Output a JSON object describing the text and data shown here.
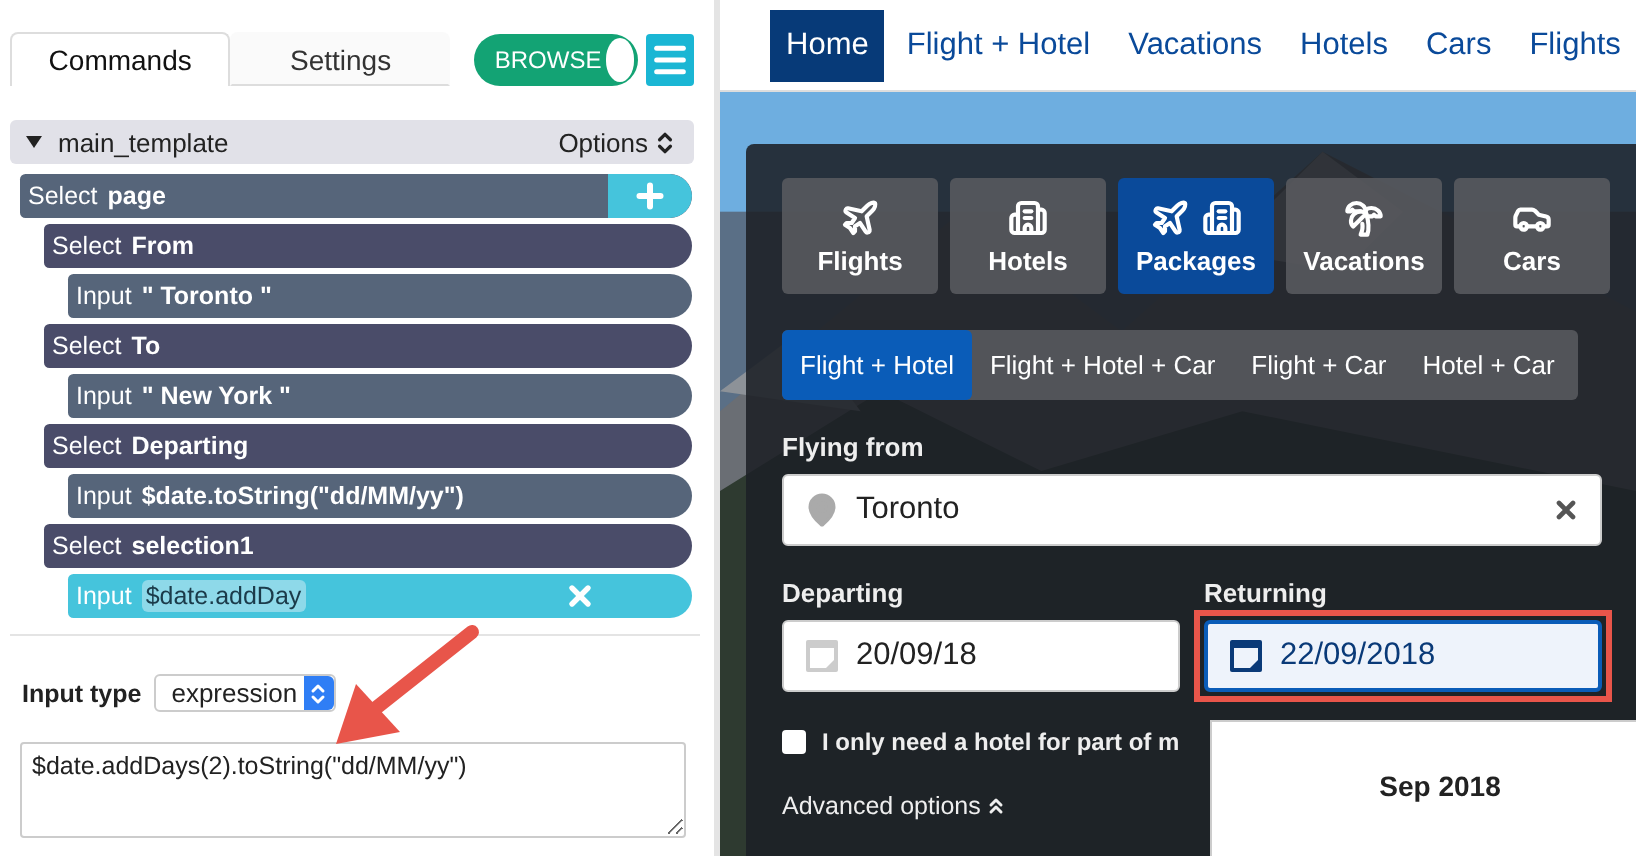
{
  "editor": {
    "tabs": [
      {
        "label": "Commands",
        "selected": true
      },
      {
        "label": "Settings",
        "selected": false
      }
    ],
    "mode_toggle": {
      "label": "BROWSE",
      "on": true
    },
    "template": {
      "name": "main_template",
      "expanded": true,
      "options_label": "Options"
    },
    "steps": [
      {
        "verb": "Select",
        "value": "page",
        "selected": false,
        "children": [
          {
            "verb": "Select",
            "value": "From",
            "selected": false,
            "children": [
              {
                "verb": "Input",
                "value": "\" Toronto \"",
                "selected": false
              }
            ]
          },
          {
            "verb": "Select",
            "value": "To",
            "selected": false,
            "children": [
              {
                "verb": "Input",
                "value": "\" New York \"",
                "selected": false
              }
            ]
          },
          {
            "verb": "Select",
            "value": "Departing",
            "selected": false,
            "children": [
              {
                "verb": "Input",
                "value": "$date.toString(\"dd/MM/yy\")",
                "selected": false
              }
            ]
          },
          {
            "verb": "Select",
            "value": "selection1",
            "selected": false,
            "children": [
              {
                "verb": "Input",
                "value": "$date.addDay",
                "selected": true
              }
            ]
          }
        ]
      }
    ],
    "input_type": {
      "label": "Input type",
      "value": "expression"
    },
    "expression": "$date.addDays(2).toString(\"dd/MM/yy\")"
  },
  "site": {
    "nav": [
      {
        "label": "Home",
        "selected": true
      },
      {
        "label": "Flight + Hotel",
        "selected": false
      },
      {
        "label": "Vacations",
        "selected": false
      },
      {
        "label": "Hotels",
        "selected": false
      },
      {
        "label": "Cars",
        "selected": false
      },
      {
        "label": "Flights",
        "selected": false
      }
    ],
    "categories": [
      {
        "label": "Flights",
        "kind": "flight",
        "selected": false
      },
      {
        "label": "Hotels",
        "kind": "hotel",
        "selected": false
      },
      {
        "label": "Packages",
        "kind": "package",
        "selected": true
      },
      {
        "label": "Vacations",
        "kind": "vacation",
        "selected": false
      },
      {
        "label": "Cars",
        "kind": "car",
        "selected": false
      }
    ],
    "package_types": [
      {
        "label": "Flight + Hotel",
        "selected": true
      },
      {
        "label": "Flight + Hotel + Car",
        "selected": false
      },
      {
        "label": "Flight + Car",
        "selected": false
      },
      {
        "label": "Hotel + Car",
        "selected": false
      }
    ],
    "flying_from": {
      "label": "Flying from",
      "value": "Toronto"
    },
    "departing": {
      "label": "Departing",
      "value": "20/09/18",
      "focused": false
    },
    "returning": {
      "label": "Returning",
      "value": "22/09/2018",
      "focused": true
    },
    "partial_hotel": {
      "label": "I only need a hotel for part of m",
      "checked": false
    },
    "advanced_options": "Advanced options",
    "calendar": {
      "month": "Sep 2018"
    }
  }
}
